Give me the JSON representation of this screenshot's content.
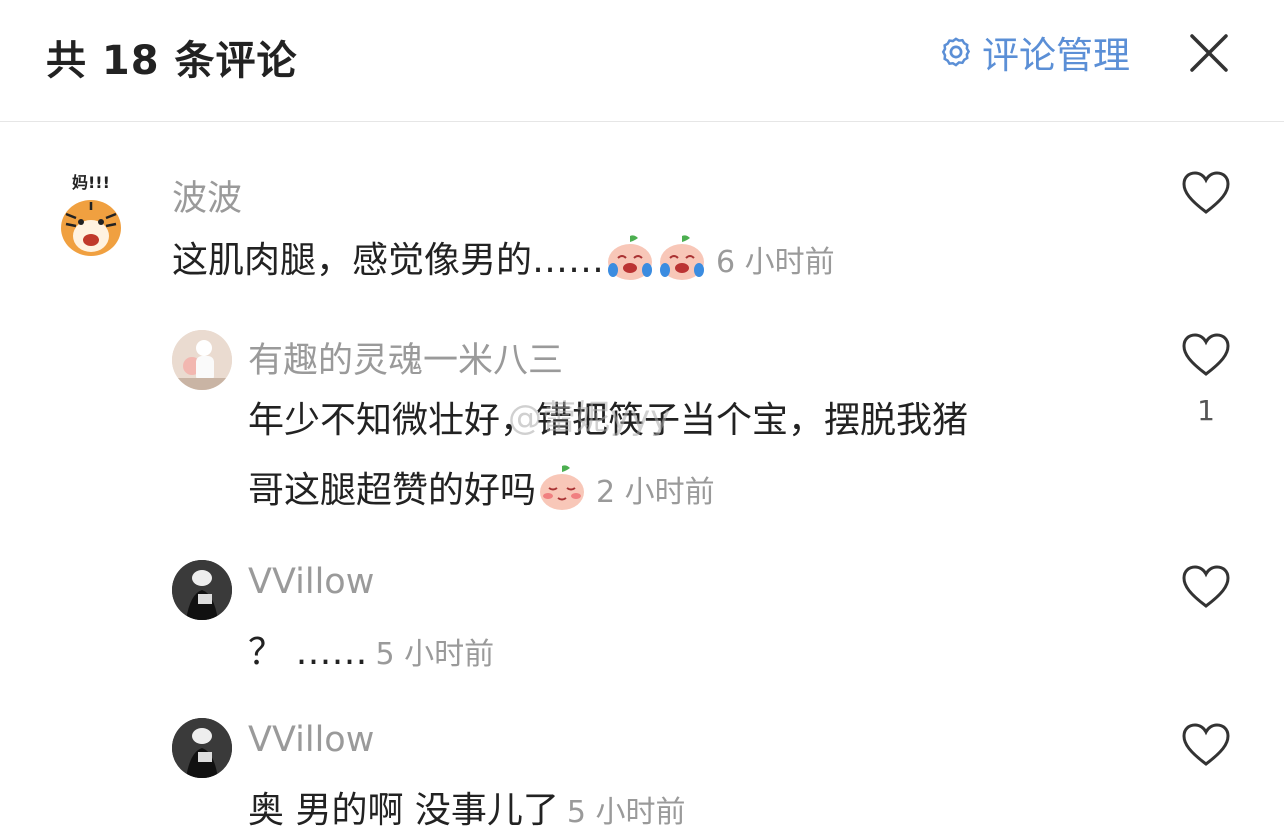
{
  "header": {
    "title": "共 18 条评论",
    "manage_label": "评论管理",
    "accent_color": "#5b8fd6"
  },
  "watermark": "@蕾妮yyy",
  "comments": [
    {
      "name": "波波",
      "avatar_text": "妈!!!",
      "text": "这肌肉腿，感觉像男的……",
      "emojis": [
        "laugh-cry-emoji",
        "laugh-cry-emoji"
      ],
      "time": "6 小时前"
    },
    {
      "name": "有趣的灵魂一米八三",
      "line1": "年少不知微壮好，错把筷子当个宝，摆脱我猪",
      "line2": "哥这腿超赞的好吗",
      "emojis": [
        "shy-emoji"
      ],
      "time": "2 小时前",
      "likes": "1"
    },
    {
      "name": "VVillow",
      "text": "？ ……",
      "time": "5 小时前"
    },
    {
      "name": "VVillow",
      "text": "奥 男的啊 没事儿了",
      "time": "5 小时前"
    }
  ]
}
